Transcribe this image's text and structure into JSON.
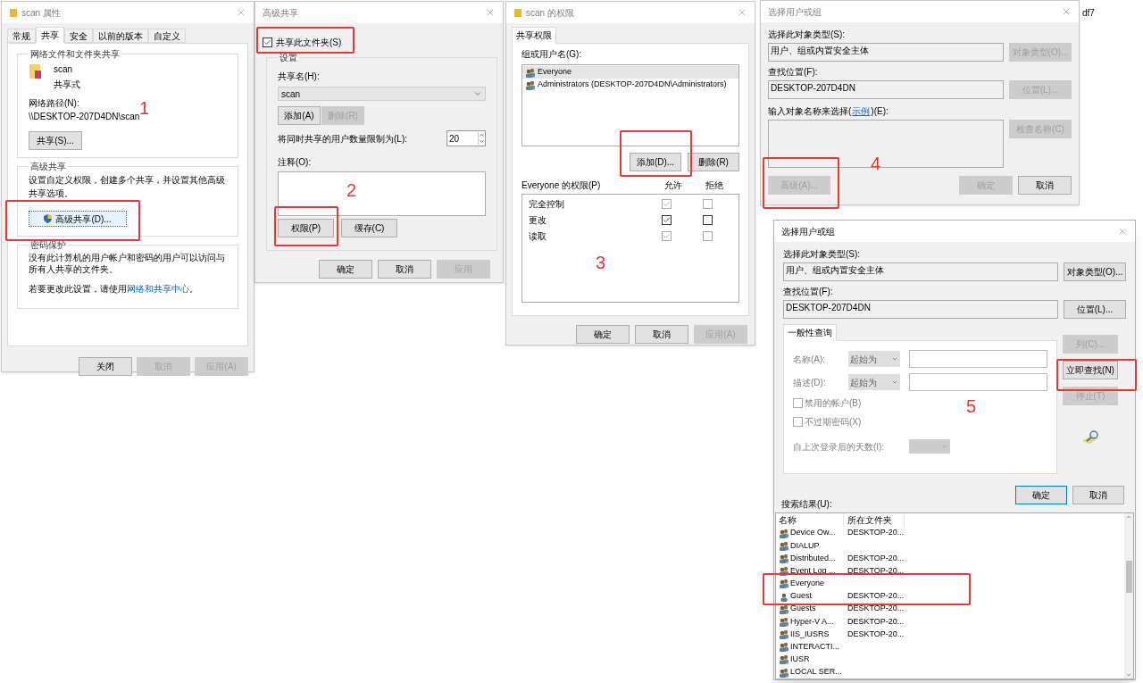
{
  "background_text": "df7",
  "properties_dialog": {
    "title": "scan 属性",
    "tabs": [
      {
        "label": "常规",
        "selected": false
      },
      {
        "label": "共享",
        "selected": true
      },
      {
        "label": "安全",
        "selected": false
      },
      {
        "label": "以前的版本",
        "selected": false
      },
      {
        "label": "自定义",
        "selected": false
      }
    ],
    "network_sharing": {
      "heading": "网络文件和文件夹共享",
      "folder_name": "scan",
      "folder_status": "共享式",
      "path_label": "网络路径(N):",
      "path": "\\\\DESKTOP-207D4DN\\scan",
      "share_button": "共享(S)..."
    },
    "advanced_sharing": {
      "heading": "高级共享",
      "description": "设置自定义权限，创建多个共享，并设置其他高级共享选项。",
      "button": "高级共享(D)..."
    },
    "password_protection": {
      "heading": "密码保护",
      "description": "没有此计算机的用户帐户和密码的用户可以访问与所有人共享的文件夹。",
      "change_prefix": "若要更改此设置，请使用",
      "change_link": "网络和共享中心",
      "change_suffix": "。"
    },
    "buttons": [
      {
        "label": "关闭",
        "disabled": false
      },
      {
        "label": "取消",
        "disabled": true
      },
      {
        "label": "应用(A)",
        "disabled": true
      }
    ]
  },
  "advanced_sharing_dialog": {
    "title": "高级共享",
    "share_checkbox": {
      "label": "共享此文件夹(S)",
      "checked": true
    },
    "settings_heading": "设置",
    "share_name_label": "共享名(H):",
    "share_name": "scan",
    "name_buttons": [
      {
        "label": "添加(A)",
        "disabled": false
      },
      {
        "label": "删除(R)",
        "disabled": true
      }
    ],
    "limit_label": "将同时共享的用户数量限制为(L):",
    "limit": "20",
    "comment_label": "注释(O):",
    "action_buttons": [
      {
        "label": "权限(P)",
        "disabled": false
      },
      {
        "label": "缓存(C)",
        "disabled": false
      }
    ],
    "buttons": [
      {
        "label": "确定",
        "disabled": false
      },
      {
        "label": "取消",
        "disabled": false
      },
      {
        "label": "应用",
        "disabled": true
      }
    ]
  },
  "permissions_dialog": {
    "title": "scan 的权限",
    "tab": {
      "label": "共享权限",
      "selected": true
    },
    "users_label": "组或用户名(G):",
    "users": [
      {
        "name": "Everyone",
        "selected": true
      },
      {
        "name": "Administrators (DESKTOP-207D4DN\\Administrators)",
        "selected": false
      }
    ],
    "user_buttons": [
      {
        "label": "添加(D)...",
        "disabled": false
      },
      {
        "label": "删除(R)",
        "disabled": false
      }
    ],
    "permissions_label": "Everyone 的权限(P)",
    "allow_heading": "允许",
    "deny_heading": "拒绝",
    "permissions": [
      {
        "name": "完全控制",
        "allow": true,
        "deny": false
      },
      {
        "name": "更改",
        "allow": true,
        "deny": false
      },
      {
        "name": "读取",
        "allow": true,
        "deny": false
      }
    ],
    "buttons": [
      {
        "label": "确定",
        "disabled": false
      },
      {
        "label": "取消",
        "disabled": false
      },
      {
        "label": "应用(A)",
        "disabled": true
      }
    ]
  },
  "select_users_dialog_back": {
    "title": "选择用户或组",
    "type_label": "选择此对象类型(S):",
    "type_value": "用户、组或内置安全主体",
    "type_button": {
      "label": "对象类型(O)...",
      "disabled": true
    },
    "location_label": "查找位置(F):",
    "location_value": "DESKTOP-207D4DN",
    "location_button": {
      "label": "位置(L)...",
      "disabled": true
    },
    "names_label_prefix": "输入对象名称来选择(",
    "names_label_link": "示例",
    "names_label_suffix": ")(E):",
    "check_button": {
      "label": "检查名称(C)",
      "disabled": true
    },
    "advanced_button": {
      "label": "高级(A)...",
      "disabled": true
    },
    "buttons": [
      {
        "label": "确定",
        "disabled": true
      },
      {
        "label": "取消",
        "disabled": false
      }
    ]
  },
  "select_users_dialog": {
    "title": "选择用户或组",
    "type_label": "选择此对象类型(S):",
    "type_value": "用户、组或内置安全主体",
    "type_button": {
      "label": "对象类型(O)...",
      "disabled": false
    },
    "location_label": "查找位置(F):",
    "location_value": "DESKTOP-207D4DN",
    "location_button": {
      "label": "位置(L)...",
      "disabled": false
    },
    "query_tab": {
      "label": "一般性查询",
      "selected": true
    },
    "query_disabled": true,
    "name_label": "名称(A):",
    "name_match": "起始为",
    "description_label": "描述(D):",
    "description_match": "起始为",
    "options": [
      {
        "label": "禁用的帐户(B)",
        "checked": false
      },
      {
        "label": "不过期密码(X)",
        "checked": false
      }
    ],
    "days_label": "自上次登录后的天数(I):",
    "side_buttons": [
      {
        "label": "列(C)...",
        "disabled": true
      },
      {
        "label": "立即查找(N)",
        "disabled": false
      },
      {
        "label": "停止(T)",
        "disabled": true
      }
    ],
    "buttons": [
      {
        "label": "确定",
        "disabled": false
      },
      {
        "label": "取消",
        "disabled": false
      }
    ],
    "results_label": "搜索结果(U):",
    "columns": [
      "名称",
      "所在文件夹"
    ],
    "results": [
      {
        "kind": "group",
        "name": "Device Ow...",
        "folder": "DESKTOP-20..."
      },
      {
        "kind": "group",
        "name": "DIALUP"
      },
      {
        "kind": "group",
        "name": "Distributed...",
        "folder": "DESKTOP-20..."
      },
      {
        "kind": "group",
        "name": "Event Log ...",
        "folder": "DESKTOP-20..."
      },
      {
        "kind": "group",
        "name": "Everyone"
      },
      {
        "kind": "user",
        "name": "Guest",
        "folder": "DESKTOP-20..."
      },
      {
        "kind": "group",
        "name": "Guests",
        "folder": "DESKTOP-20..."
      },
      {
        "kind": "group",
        "name": "Hyper-V A...",
        "folder": "DESKTOP-20..."
      },
      {
        "kind": "group",
        "name": "IIS_IUSRS",
        "folder": "DESKTOP-20..."
      },
      {
        "kind": "group",
        "name": "INTERACTI..."
      },
      {
        "kind": "group",
        "name": "IUSR"
      },
      {
        "kind": "group",
        "name": "LOCAL SER..."
      }
    ]
  },
  "annotations": [
    {
      "label": "1"
    },
    {
      "label": "2"
    },
    {
      "label": "3"
    },
    {
      "label": "4"
    },
    {
      "label": "5"
    }
  ]
}
